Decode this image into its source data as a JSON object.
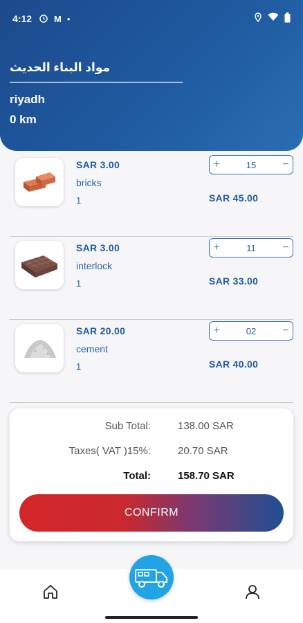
{
  "status_bar": {
    "time": "4:12",
    "left_icons": [
      "alarm-icon",
      "mcdonalds-icon",
      "dot-icon"
    ],
    "right_icons": [
      "location-icon",
      "wifi-icon",
      "battery-icon"
    ]
  },
  "header": {
    "store_name": "مواد البناء الحديث",
    "city": "riyadh",
    "distance": "0 km"
  },
  "items": [
    {
      "price": "SAR  3.00",
      "name": "bricks",
      "unit": "1",
      "qty": "15",
      "line_total": "SAR  45.00",
      "image": "bricks-image"
    },
    {
      "price": "SAR  3.00",
      "name": "interlock",
      "unit": "1",
      "qty": "11",
      "line_total": "SAR  33.00",
      "image": "interlock-image"
    },
    {
      "price": "SAR  20.00",
      "name": "cement",
      "unit": "1",
      "qty": "02",
      "line_total": "SAR  40.00",
      "image": "cement-image"
    }
  ],
  "stepper": {
    "plus": "+",
    "minus": "−"
  },
  "summary": {
    "subtotal_label": "Sub Total:",
    "subtotal_value": "138.00 SAR",
    "tax_label": "Taxes( VAT )15%:",
    "tax_value": "20.70 SAR",
    "total_label": "Total:",
    "total_value": "158.70 SAR"
  },
  "confirm_label": "CONFIRM",
  "nav": {
    "home_icon": "home-icon",
    "center_icon": "truck-icon",
    "profile_icon": "profile-icon"
  },
  "colors": {
    "primary": "#1f5aa0",
    "accent_red": "#d3262a",
    "fab": "#20a4e6"
  }
}
